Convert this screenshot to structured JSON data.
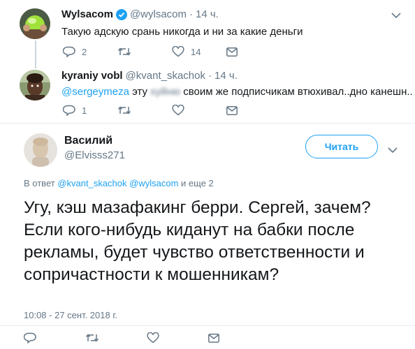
{
  "tweets": [
    {
      "name": "Wylsacom",
      "verified": true,
      "handle": "@wylsacom",
      "time": "14 ч.",
      "text": "Такую адскую срань никогда и ни за какие деньги",
      "replies": "2",
      "retweets": "",
      "likes": "14"
    },
    {
      "name": "kyraniy vobl",
      "handle": "@kvant_skachok",
      "time": "14 ч.",
      "mention": "@sergeymeza",
      "text_before": "эту",
      "censored": "хуйню",
      "text_after": "своим же подписчикам втюхивал..дно канешн..",
      "replies": "1",
      "retweets": "",
      "likes": ""
    }
  ],
  "main_tweet": {
    "name": "Василий",
    "handle": "@Elvisss271",
    "follow_label": "Читать",
    "reply_prefix": "В ответ",
    "reply_to_1": "@kvant_skachok",
    "reply_to_2": "@wylsacom",
    "reply_suffix": "и еще 2",
    "text": "Угу, кэш мазафакинг берри. Сергей, зачем? Если кого-нибудь киданут на бабки после рекламы, будет чувство ответственности и сопричастности к мошенникам?",
    "timestamp": "10:08 - 27 сент. 2018 г."
  },
  "icons": {
    "reply": "reply-icon",
    "retweet": "retweet-icon",
    "like": "heart-icon",
    "dm": "envelope-icon",
    "more": "chevron-down-icon",
    "verified": "verified-badge-icon"
  },
  "colors": {
    "accent": "#1da1f2",
    "text": "#14171a",
    "muted": "#657786"
  }
}
